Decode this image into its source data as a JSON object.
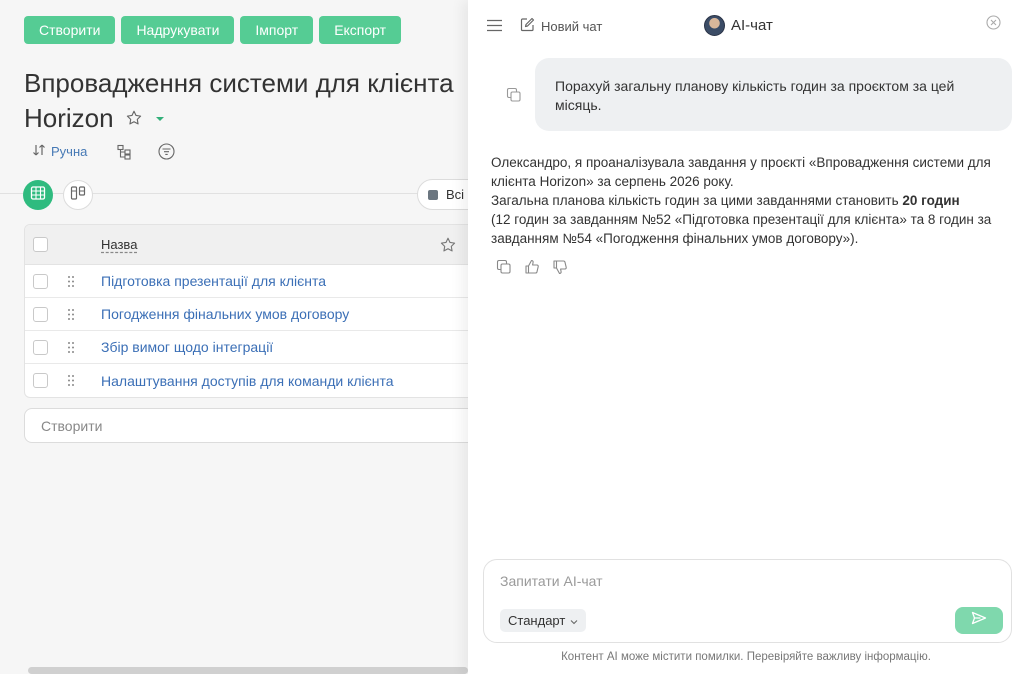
{
  "toolbar": {
    "create_label": "Створити",
    "print_label": "Надрукувати",
    "import_label": "Імпорт",
    "export_label": "Експорт"
  },
  "project": {
    "title": "Впровадження системи для клієнта Horizon"
  },
  "subbar": {
    "sort_label": "Ручна"
  },
  "filters": {
    "all_label": "Всі"
  },
  "table": {
    "header_name": "Назва",
    "rows": [
      {
        "name": "Підготовка презентації для клієнта"
      },
      {
        "name": "Погодження фінальних умов договору"
      },
      {
        "name": "Збір вимог щодо інтеграції"
      },
      {
        "name": "Налаштування доступів для команди клієнта"
      }
    ]
  },
  "create_placeholder": "Створити",
  "chat": {
    "new_chat_label": "Новий чат",
    "title": "AI-чат",
    "user_message": "Порахуй загальну планову кількість годин за проєктом за цей місяць.",
    "ai_line1": "Олександро, я проаналізувала завдання у проєкті «Впровадження системи для клієнта Horizon» за серпень 2026 року.",
    "ai_line2_pre": "Загальна планова кількість годин за цими завданнями становить ",
    "ai_line2_bold": "20 годин",
    "ai_line3": "(12 годин за завданням №52 «Підготовка презентації для клієнта» та 8 годин за завданням №54 «Погодження фінальних умов договору»).",
    "input_placeholder": "Запитати AI-чат",
    "mode_label": "Стандарт",
    "disclaimer": "Контент AI може містити помилки. Перевіряйте важливу інформацію."
  },
  "colors": {
    "accent": "#55cc94",
    "link": "#3b6fb6",
    "send": "#7fd8ad"
  }
}
